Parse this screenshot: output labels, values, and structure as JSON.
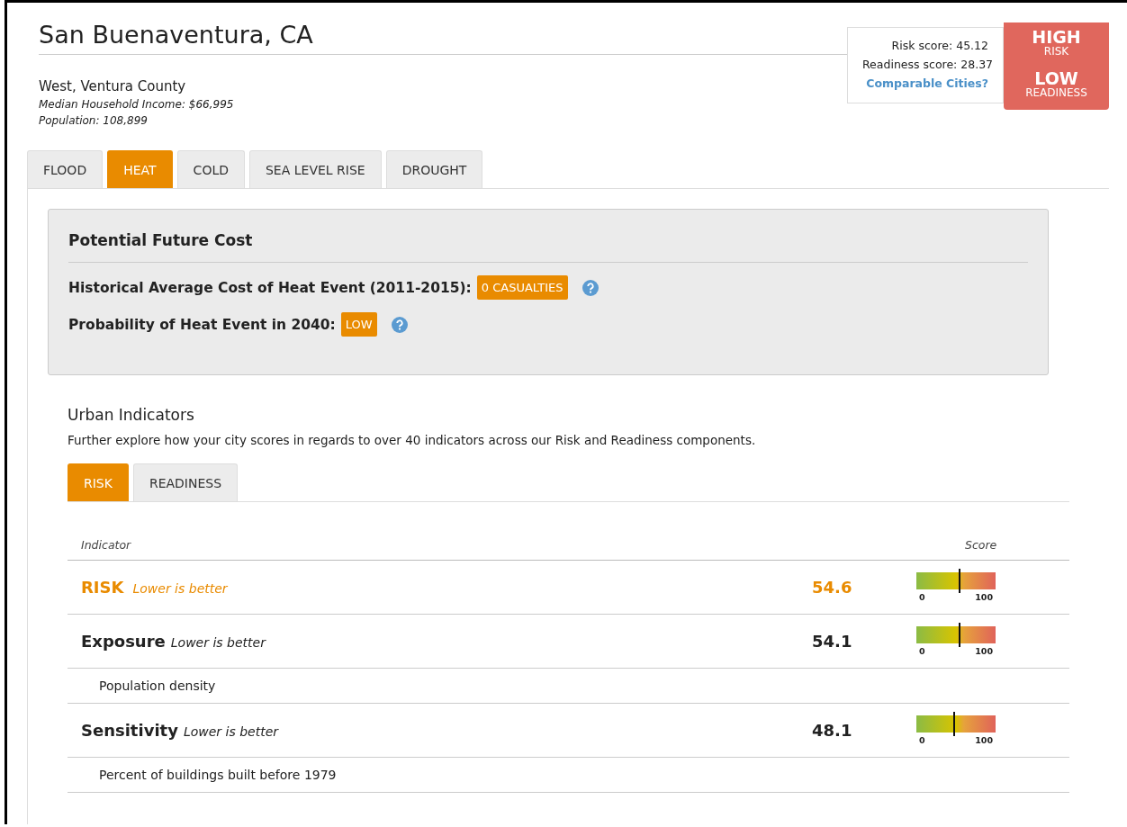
{
  "city": {
    "name": "San Buenaventura, CA",
    "region": "West, Ventura County",
    "income": "Median Household Income: $66,995",
    "population": "Population: 108,899"
  },
  "scores": {
    "risk": "Risk score: 45.12",
    "readiness": "Readiness score: 28.37",
    "link": "Comparable Cities?"
  },
  "rating": {
    "risk_level": "HIGH",
    "risk_label": "RISK",
    "readiness_level": "LOW",
    "readiness_label": "READINESS"
  },
  "hazard_tabs": [
    {
      "label": "FLOOD",
      "selected": false
    },
    {
      "label": "HEAT",
      "selected": true
    },
    {
      "label": "COLD",
      "selected": false
    },
    {
      "label": "SEA LEVEL RISE",
      "selected": false
    },
    {
      "label": "DROUGHT",
      "selected": false
    }
  ],
  "future_cost": {
    "title": "Potential Future Cost",
    "items": [
      {
        "label": "Historical Average Cost of Heat Event (2011-2015):",
        "badge": "0 CASUALTIES"
      },
      {
        "label": "Probability of Heat Event in 2040:",
        "badge": "LOW"
      }
    ]
  },
  "urban_indicators": {
    "title": "Urban Indicators",
    "description": "Further explore how your city scores in regards to over 40 indicators across our Risk and Readiness components.",
    "tabs": [
      {
        "label": "RISK",
        "selected": true
      },
      {
        "label": "READINESS",
        "selected": false
      }
    ],
    "columns": [
      "Indicator",
      "Score"
    ],
    "rows": [
      {
        "kind": "total",
        "name": "RISK",
        "note": "Lower is better",
        "score": "54.6",
        "level": 0.546,
        "min": "0",
        "max": "100"
      },
      {
        "kind": "component",
        "name": "Exposure",
        "note": "Lower is better",
        "score": "54.1",
        "level": 0.541,
        "min": "0",
        "max": "100"
      },
      {
        "kind": "sub",
        "name": "Population density"
      },
      {
        "kind": "component",
        "name": "Sensitivity",
        "note": "Lower is better",
        "score": "48.1",
        "level": 0.481,
        "min": "0",
        "max": "100"
      },
      {
        "kind": "sub",
        "name": "Percent of buildings built before 1979"
      }
    ]
  }
}
